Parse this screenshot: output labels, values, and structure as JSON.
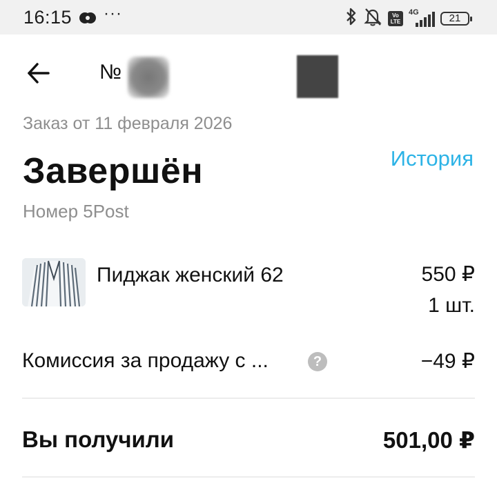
{
  "status_bar": {
    "time": "16:15",
    "dots": "···",
    "network": "4G",
    "volte": "Vo LTE",
    "battery": "21",
    "icons": [
      "messenger-icon",
      "bluetooth-icon",
      "bell-off-icon",
      "volte-icon",
      "signal-icon",
      "battery-icon"
    ]
  },
  "header": {
    "back_icon": "arrow-left-icon",
    "order_number_prefix": "№"
  },
  "order": {
    "date": "Заказ от 11 февраля 2026",
    "status": "Завершён",
    "history_link": "История",
    "delivery": "Номер 5Post"
  },
  "item": {
    "title": "Пиджак женский 62",
    "price": "550 ₽",
    "quantity": "1 шт."
  },
  "commission": {
    "label": "Комиссия за продажу с ...",
    "help": "?",
    "value": "−49 ₽"
  },
  "total": {
    "label": "Вы получили",
    "value": "501,00 ₽"
  },
  "colors": {
    "accent": "#2cb3e6",
    "secondary_text": "#8e8e8e",
    "status_bar_bg": "#f1f1f1"
  }
}
